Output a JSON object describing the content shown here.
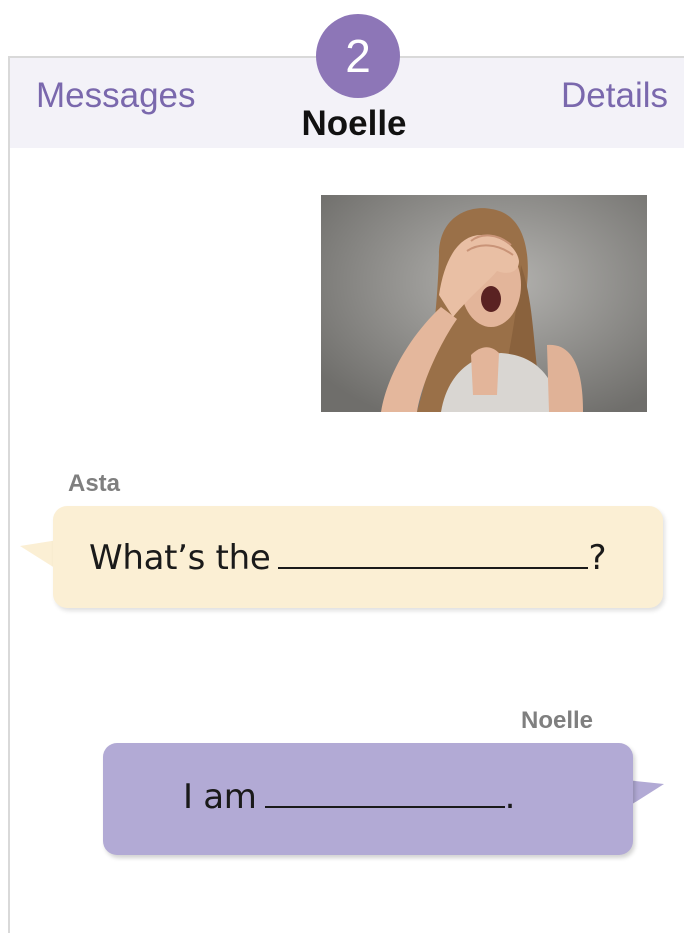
{
  "header": {
    "back_label": "Messages",
    "details_label": "Details",
    "unread_count": "2",
    "contact_name": "Noelle"
  },
  "photo": {
    "description_icon": "photo-woman-covering-eyes"
  },
  "messages": [
    {
      "sender": "Asta",
      "text_before": "What’s the",
      "text_after": "?",
      "direction": "incoming",
      "color": "#fbefd4"
    },
    {
      "sender": "Noelle",
      "text_before": "I am",
      "text_after": ".",
      "direction": "outgoing",
      "color": "#b2aad5"
    }
  ],
  "colors": {
    "accent": "#7a68ad",
    "badge": "#8d76b7",
    "header_bg": "#f3f2f8"
  }
}
